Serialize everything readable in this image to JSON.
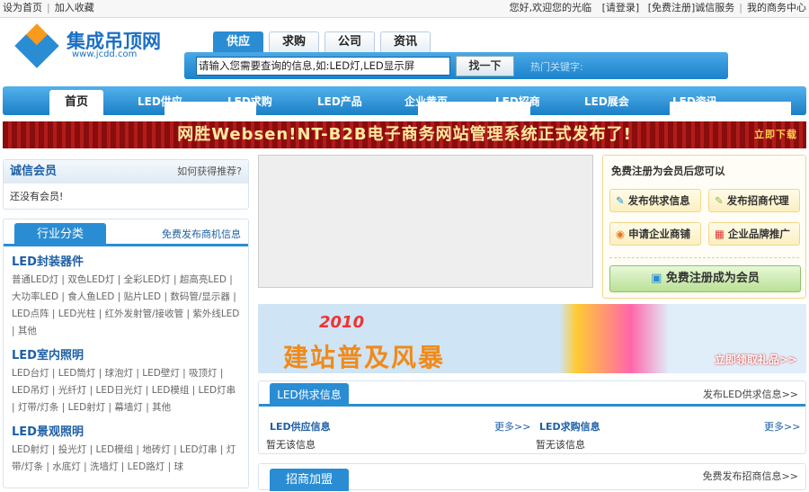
{
  "topbar": {
    "set_home": "设为首页",
    "bookmark": "加入收藏",
    "welcome": "您好,欢迎您的光临",
    "login": "[请登录]",
    "register": "[免费注册]",
    "trust": "诚信服务",
    "my_business": "我的商务中心"
  },
  "logo": {
    "name": "集成吊顶网",
    "url": "www.jcdd.com"
  },
  "search": {
    "tabs": [
      "供应",
      "求购",
      "公司",
      "资讯"
    ],
    "placeholder": "请输入您需要查询的信息,如:LED灯,LED显示屏",
    "button": "找一下",
    "hot_label": "热门关键字:"
  },
  "nav": [
    "首页",
    "LED供应",
    "LED求购",
    "LED产品",
    "企业黄页",
    "LED招商",
    "LED展会",
    "LED资讯"
  ],
  "banner": {
    "text": "网胜Websen!NT-B2B电子商务网站管理系统正式发布了!",
    "cta": "立即下载"
  },
  "members": {
    "title": "诚信会员",
    "link": "如何获得推荐?",
    "empty": "还没有会员!"
  },
  "categories": {
    "tab": "行业分类",
    "link": "免费发布商机信息",
    "groups": [
      {
        "title": "LED封装器件",
        "items": "普通LED灯 | 双色LED灯 | 全彩LED灯 | 超高亮LED | 大功率LED | 食人鱼LED | 贴片LED | 数码管/显示器 | LED点阵 | LED光柱 | 红外发射管/接收管 | 紫外线LED | 其他"
      },
      {
        "title": "LED室内照明",
        "items": "LED台灯 | LED筒灯 | 球泡灯 | LED壁灯 | 吸顶灯 | LED吊灯 | 光纤灯 | LED日光灯 | LED模组 | LED灯串 | 灯带/灯条 | LED射灯 | 幕墙灯 | 其他"
      },
      {
        "title": "LED景观照明",
        "items": "LED射灯 | 投光灯 | LED模组 | 地砖灯 | LED灯串 | 灯带/灯条 | 水底灯 | 洗墙灯 | LED路灯 | 球"
      }
    ]
  },
  "register_box": {
    "title": "免费注册为会员后您可以",
    "buttons": [
      "发布供求信息",
      "发布招商代理",
      "申请企业商铺",
      "企业品牌推广"
    ],
    "main": "免费注册成为会员"
  },
  "ad": {
    "year": "2010",
    "slogan": "建站普及风暴",
    "cta": "立即领取礼品>>"
  },
  "supply": {
    "tab": "LED供求信息",
    "link": "发布LED供求信息>>",
    "left_title": "LED供应信息",
    "right_title": "LED求购信息",
    "more": "更多>>",
    "empty": "暂无该信息"
  },
  "franchise": {
    "tab": "招商加盟",
    "link": "免费发布招商信息>>"
  }
}
